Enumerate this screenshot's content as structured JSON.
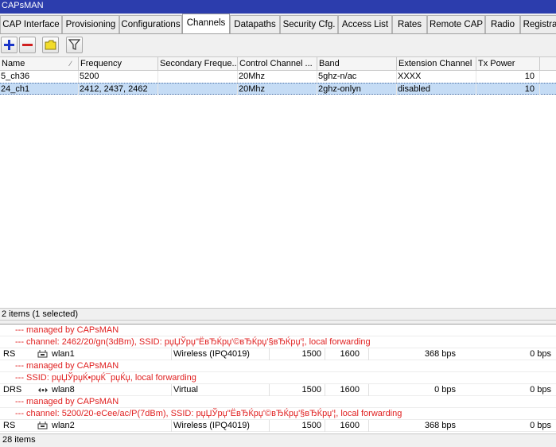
{
  "window": {
    "title": "CAPsMAN"
  },
  "tabs": [
    {
      "label": "CAP Interface"
    },
    {
      "label": "Provisioning"
    },
    {
      "label": "Configurations"
    },
    {
      "label": "Channels"
    },
    {
      "label": "Datapaths"
    },
    {
      "label": "Security Cfg."
    },
    {
      "label": "Access List"
    },
    {
      "label": "Rates"
    },
    {
      "label": "Remote CAP"
    },
    {
      "label": "Radio"
    },
    {
      "label": "Registra"
    }
  ],
  "active_tab": "Channels",
  "toolbar": [
    "add-icon",
    "remove-icon",
    "comment-icon",
    "filter-icon"
  ],
  "channels": {
    "columns": [
      "Name",
      "Frequency",
      "Secondary Freque...",
      "Control Channel ...",
      "Band",
      "Extension Channel",
      "Tx Power"
    ],
    "rows": [
      {
        "name": "5_ch36",
        "frequency": "5200",
        "secondary": "",
        "control": "20Mhz",
        "band": "5ghz-n/ac",
        "extension": "XXXX",
        "tx_power": "10",
        "selected": false
      },
      {
        "name": "24_ch1",
        "frequency": "2412, 2437, 2462",
        "secondary": "",
        "control": "20Mhz",
        "band": "2ghz-onlyn",
        "extension": "disabled",
        "tx_power": "10",
        "selected": true
      }
    ],
    "status": "2 items (1 selected)"
  },
  "interfaces": {
    "rows": [
      {
        "kind": "comment",
        "text": "--- managed by CAPsMAN"
      },
      {
        "kind": "comment",
        "text": "--- channel: 2462/20/gn(3dBm), SSID: рџЏЎрџ\"ЁвЂЌрџ'©вЂЌрџ'§вЂЌрџ'¦, local forwarding"
      },
      {
        "kind": "iface",
        "flags": "RS",
        "icon": "wireless-icon",
        "name": "wlan1",
        "type": "Wireless (IPQ4019)",
        "mtu": "1500",
        "l2mtu": "1600",
        "tx": "368 bps",
        "rx": "0 bps"
      },
      {
        "kind": "comment",
        "text": "--- managed by CAPsMAN"
      },
      {
        "kind": "comment",
        "text": "--- SSID: рџЏЎрџЌ•рџЌ¯рџЌџ, local forwarding"
      },
      {
        "kind": "iface",
        "flags": "DRS",
        "icon": "virtual-icon",
        "name": "wlan8",
        "type": "Virtual",
        "mtu": "1500",
        "l2mtu": "1600",
        "tx": "0 bps",
        "rx": "0 bps"
      },
      {
        "kind": "comment",
        "text": "--- managed by CAPsMAN"
      },
      {
        "kind": "comment",
        "text": "--- channel: 5200/20-eCee/ac/P(7dBm), SSID: рџЏЎрџ\"ЁвЂЌрџ'©вЂЌрџ'§вЂЌрџ'¦, local forwarding"
      },
      {
        "kind": "iface",
        "flags": "RS",
        "icon": "wireless-icon",
        "name": "wlan2",
        "type": "Wireless (IPQ4019)",
        "mtu": "1500",
        "l2mtu": "1600",
        "tx": "368 bps",
        "rx": "0 bps"
      }
    ],
    "status": "28 items"
  },
  "colors": {
    "title_bar": "#2c3dad",
    "selection": "#c5dcf5",
    "comment_text": "#e02020"
  }
}
